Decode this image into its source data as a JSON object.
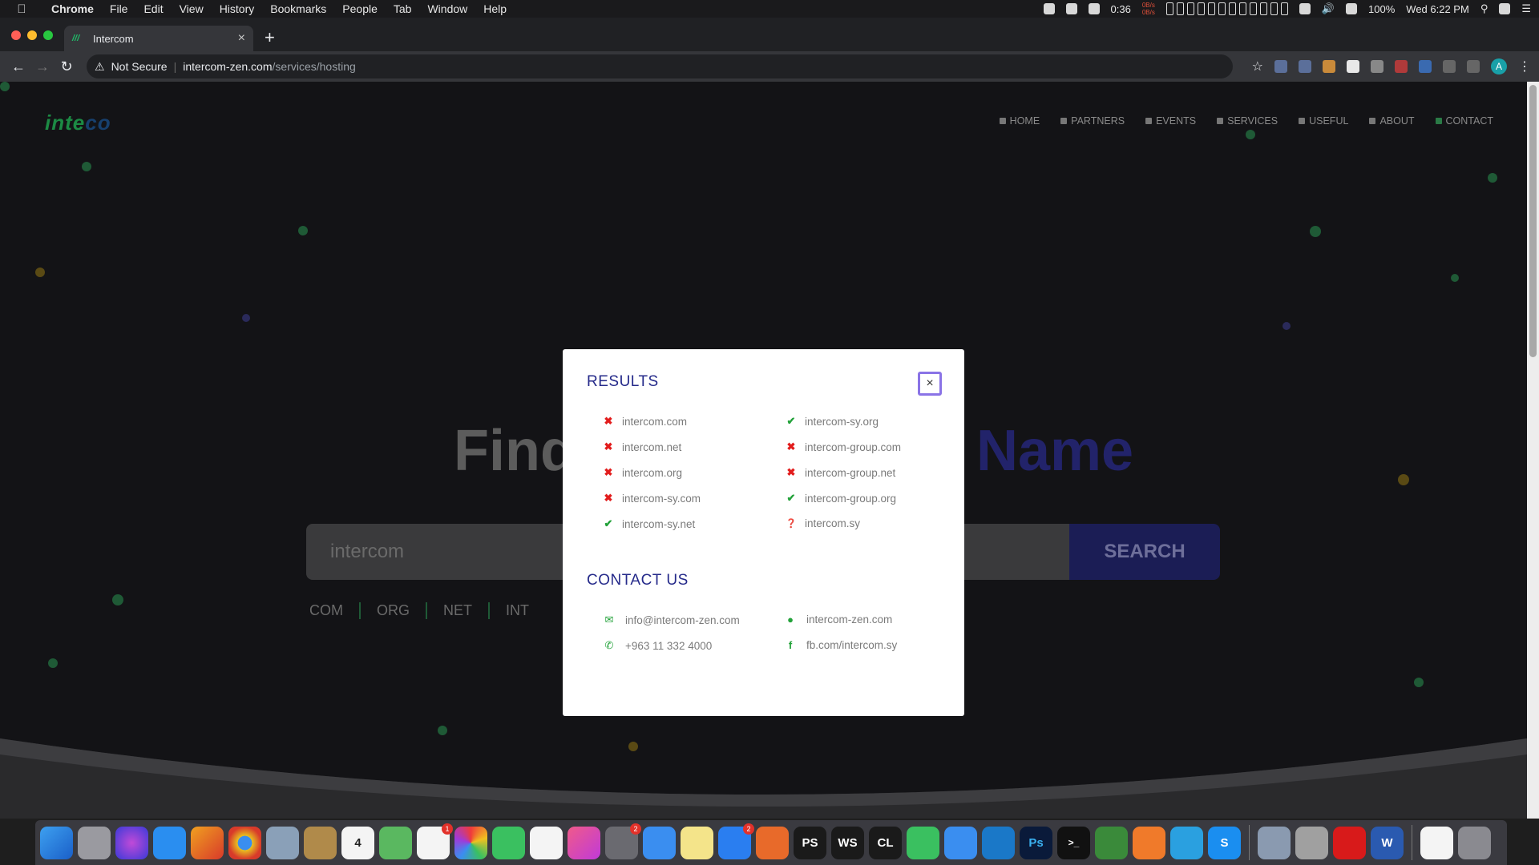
{
  "menubar": {
    "app": "Chrome",
    "items": [
      "File",
      "Edit",
      "View",
      "History",
      "Bookmarks",
      "People",
      "Tab",
      "Window",
      "Help"
    ],
    "timer": "0:36",
    "net_tx": "0B/s",
    "net_rx": "0B/s",
    "battery": "100%",
    "clock": "Wed 6:22 PM"
  },
  "browser": {
    "tab_title": "Intercom",
    "tab_close": "×",
    "new_tab": "+",
    "security": "Not Secure",
    "url_host": "intercom-zen.com",
    "url_path": "/services/hosting",
    "avatar_letter": "A"
  },
  "site": {
    "logo_a": "inte",
    "logo_b": "co",
    "nav": [
      {
        "label": "HOME",
        "icon": "home-icon"
      },
      {
        "label": "PARTNERS",
        "icon": "user-icon"
      },
      {
        "label": "EVENTS",
        "icon": "image-icon"
      },
      {
        "label": "SERVICES",
        "icon": "gear-icon"
      },
      {
        "label": "USEFUL",
        "icon": "chat-icon"
      },
      {
        "label": "ABOUT",
        "icon": "user-icon"
      },
      {
        "label": "CONTACT",
        "icon": "envelope-icon"
      }
    ],
    "hero_left": "Find",
    "hero_right": "Name",
    "search_value": "intercom",
    "search_button": "SEARCH",
    "tlds": [
      "COM",
      "ORG",
      "NET",
      "INT"
    ]
  },
  "modal": {
    "results_title": "RESULTS",
    "contact_title": "CONTACT US",
    "close_label": "×",
    "results_left": [
      {
        "domain": "intercom.com",
        "status": "taken"
      },
      {
        "domain": "intercom.net",
        "status": "taken"
      },
      {
        "domain": "intercom.org",
        "status": "taken"
      },
      {
        "domain": "intercom-sy.com",
        "status": "taken"
      },
      {
        "domain": "intercom-sy.net",
        "status": "available"
      }
    ],
    "results_right": [
      {
        "domain": "intercom-sy.org",
        "status": "available"
      },
      {
        "domain": "intercom-group.com",
        "status": "taken"
      },
      {
        "domain": "intercom-group.net",
        "status": "taken"
      },
      {
        "domain": "intercom-group.org",
        "status": "available"
      },
      {
        "domain": "intercom.sy",
        "status": "unknown"
      }
    ],
    "contact": {
      "email": "info@intercom-zen.com",
      "website": "intercom-zen.com",
      "phone": "+963 11 332 4000",
      "facebook": "fb.com/intercom.sy"
    },
    "colors": {
      "heading": "#252a8a",
      "taken": "#e21c1c",
      "available": "#23a23a",
      "focus_ring": "#8a73e6"
    }
  },
  "dock": {
    "badges": {
      "reminders": "1",
      "system_prefs": "2",
      "app_store": "2"
    },
    "calendar_day": "4",
    "calendar_month": "DEC"
  }
}
